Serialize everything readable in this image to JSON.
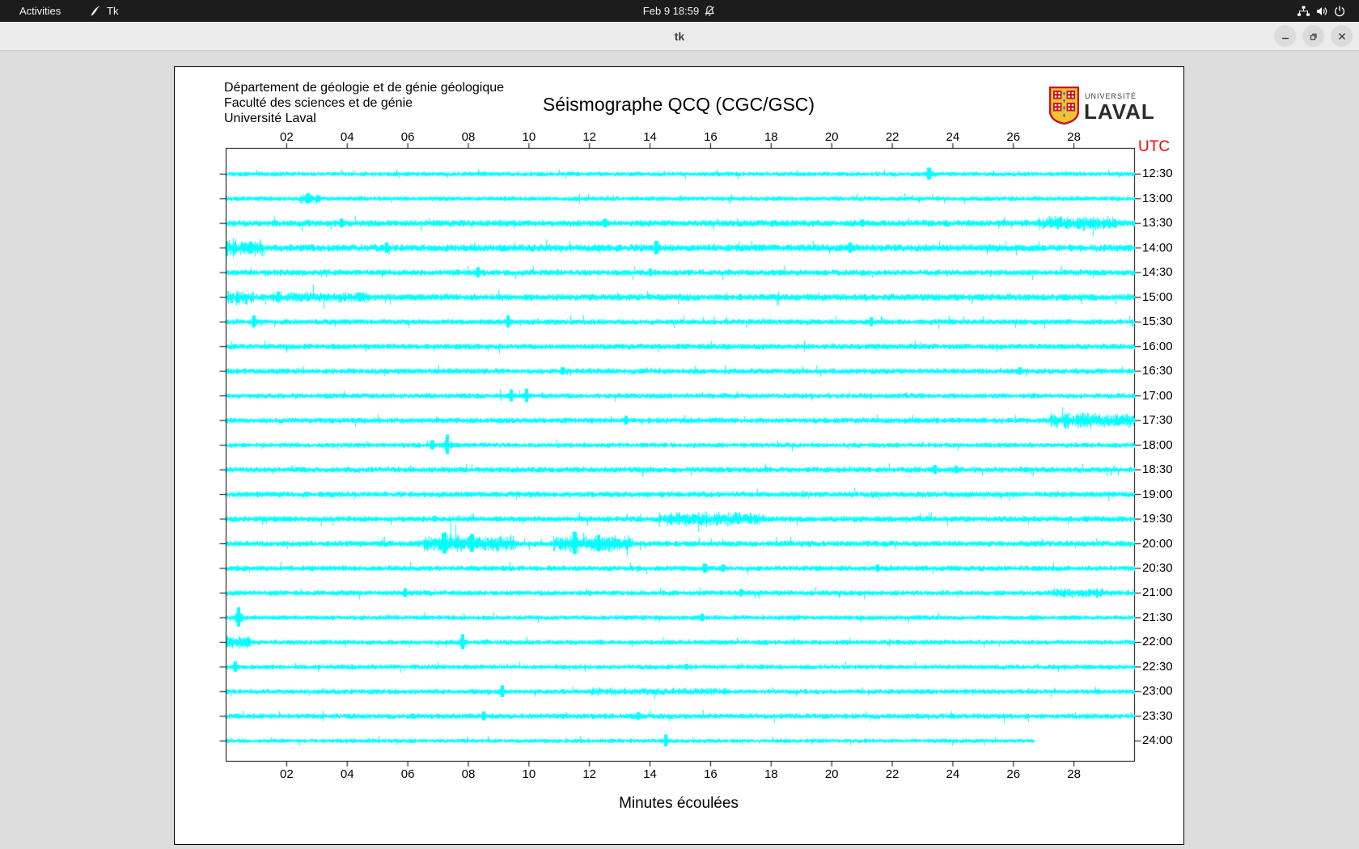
{
  "topbar": {
    "activities": "Activities",
    "app": "Tk",
    "clock": "Feb 9 18:59",
    "icons": [
      "tk-feather",
      "bell-muted",
      "network",
      "volume",
      "power"
    ]
  },
  "titlebar": {
    "title": "tk",
    "buttons": [
      "minimize",
      "maximize",
      "close"
    ]
  },
  "window": {
    "header_lines": [
      "Département de géologie et de génie géologique",
      "Faculté des sciences et de génie",
      "Université Laval"
    ],
    "logo": {
      "small": "UNIVERSITÉ",
      "big": "LAVAL"
    }
  },
  "chart_data": {
    "type": "line",
    "subtype": "seismogram-helicorder",
    "title": "Séismographe QCQ (CGC/GSC)",
    "xlabel": "Minutes écoulées",
    "y_axis_label": "UTC",
    "x_range": [
      0,
      30
    ],
    "x_tick_values": [
      2,
      4,
      6,
      8,
      10,
      12,
      14,
      16,
      18,
      20,
      22,
      24,
      26,
      28
    ],
    "x_ticks": [
      "02",
      "04",
      "06",
      "08",
      "10",
      "12",
      "14",
      "16",
      "18",
      "20",
      "22",
      "24",
      "26",
      "28"
    ],
    "grid": false,
    "trace_color": "#00ffff",
    "utc_color": "#ff0000",
    "rows": [
      {
        "utc": "12:30",
        "amp": 2.3,
        "spikes": [
          [
            23.2,
            8
          ]
        ],
        "bursts": [],
        "end": 30
      },
      {
        "utc": "13:00",
        "amp": 2.4,
        "spikes": [
          [
            2.7,
            7
          ]
        ],
        "bursts": [
          [
            2.4,
            3.1,
            1.8
          ]
        ],
        "end": 30
      },
      {
        "utc": "13:30",
        "amp": 3.3,
        "spikes": [
          [
            3.8,
            6
          ],
          [
            12.5,
            6
          ],
          [
            21.0,
            5
          ]
        ],
        "bursts": [
          [
            26.8,
            29.4,
            1.8
          ]
        ],
        "end": 30
      },
      {
        "utc": "14:00",
        "amp": 3.6,
        "spikes": [
          [
            0.8,
            8
          ],
          [
            5.3,
            7
          ],
          [
            14.2,
            9
          ],
          [
            20.6,
            7
          ]
        ],
        "bursts": [
          [
            0,
            1.2,
            2.0
          ]
        ],
        "end": 30
      },
      {
        "utc": "14:30",
        "amp": 3.0,
        "spikes": [
          [
            8.3,
            7
          ],
          [
            14.0,
            5
          ]
        ],
        "bursts": [],
        "end": 30
      },
      {
        "utc": "15:00",
        "amp": 3.4,
        "spikes": [
          [
            1.7,
            7
          ],
          [
            4.4,
            6
          ]
        ],
        "bursts": [
          [
            0,
            0.9,
            1.8
          ],
          [
            1.5,
            4.7,
            1.4
          ]
        ],
        "end": 30
      },
      {
        "utc": "15:30",
        "amp": 2.8,
        "spikes": [
          [
            0.9,
            8
          ],
          [
            9.3,
            8
          ],
          [
            21.3,
            6
          ]
        ],
        "bursts": [],
        "end": 30
      },
      {
        "utc": "16:00",
        "amp": 2.9,
        "spikes": [],
        "bursts": [],
        "end": 30
      },
      {
        "utc": "16:30",
        "amp": 2.8,
        "spikes": [
          [
            11.1,
            5
          ],
          [
            26.2,
            5
          ]
        ],
        "bursts": [],
        "end": 30
      },
      {
        "utc": "17:00",
        "amp": 2.6,
        "spikes": [
          [
            9.4,
            8
          ],
          [
            9.9,
            9
          ]
        ],
        "bursts": [],
        "end": 30
      },
      {
        "utc": "17:30",
        "amp": 2.8,
        "spikes": [
          [
            13.2,
            6
          ]
        ],
        "bursts": [
          [
            27.2,
            30,
            2.2
          ]
        ],
        "end": 30
      },
      {
        "utc": "18:00",
        "amp": 2.5,
        "spikes": [
          [
            6.8,
            6
          ],
          [
            7.3,
            13
          ]
        ],
        "bursts": [],
        "end": 30
      },
      {
        "utc": "18:30",
        "amp": 2.9,
        "spikes": [
          [
            23.4,
            6
          ],
          [
            24.1,
            5
          ]
        ],
        "bursts": [],
        "end": 30
      },
      {
        "utc": "19:00",
        "amp": 2.9,
        "spikes": [],
        "bursts": [],
        "end": 30
      },
      {
        "utc": "19:30",
        "amp": 3.0,
        "spikes": [],
        "bursts": [
          [
            14.3,
            17.6,
            1.9
          ]
        ],
        "end": 30
      },
      {
        "utc": "20:00",
        "amp": 3.0,
        "spikes": [
          [
            7.2,
            14
          ],
          [
            8.1,
            12
          ],
          [
            11.5,
            15
          ],
          [
            12.3,
            11
          ]
        ],
        "bursts": [
          [
            6.5,
            9.5,
            2.4
          ],
          [
            10.8,
            13.4,
            2.2
          ]
        ],
        "end": 30
      },
      {
        "utc": "20:30",
        "amp": 2.8,
        "spikes": [
          [
            15.8,
            6
          ],
          [
            16.4,
            5
          ],
          [
            21.5,
            5
          ]
        ],
        "bursts": [],
        "end": 30
      },
      {
        "utc": "21:00",
        "amp": 2.7,
        "spikes": [
          [
            5.9,
            6
          ],
          [
            17.0,
            5
          ]
        ],
        "bursts": [
          [
            27.3,
            29,
            1.5
          ]
        ],
        "end": 30
      },
      {
        "utc": "21:30",
        "amp": 2.4,
        "spikes": [
          [
            0.4,
            13
          ],
          [
            15.7,
            5
          ]
        ],
        "bursts": [],
        "end": 30
      },
      {
        "utc": "22:00",
        "amp": 2.5,
        "spikes": [
          [
            7.8,
            10
          ]
        ],
        "bursts": [
          [
            0,
            0.8,
            2.2
          ]
        ],
        "end": 30
      },
      {
        "utc": "22:30",
        "amp": 2.4,
        "spikes": [
          [
            0.3,
            7
          ],
          [
            15.2,
            4
          ]
        ],
        "bursts": [],
        "end": 30
      },
      {
        "utc": "23:00",
        "amp": 2.5,
        "spikes": [
          [
            9.1,
            8
          ]
        ],
        "bursts": [
          [
            12,
            16.5,
            1.3
          ]
        ],
        "end": 30
      },
      {
        "utc": "23:30",
        "amp": 2.7,
        "spikes": [
          [
            8.5,
            6
          ],
          [
            13.6,
            5
          ]
        ],
        "bursts": [],
        "end": 30
      },
      {
        "utc": "24:00",
        "amp": 2.2,
        "spikes": [
          [
            14.5,
            8
          ]
        ],
        "bursts": [],
        "end": 26.7
      }
    ]
  }
}
